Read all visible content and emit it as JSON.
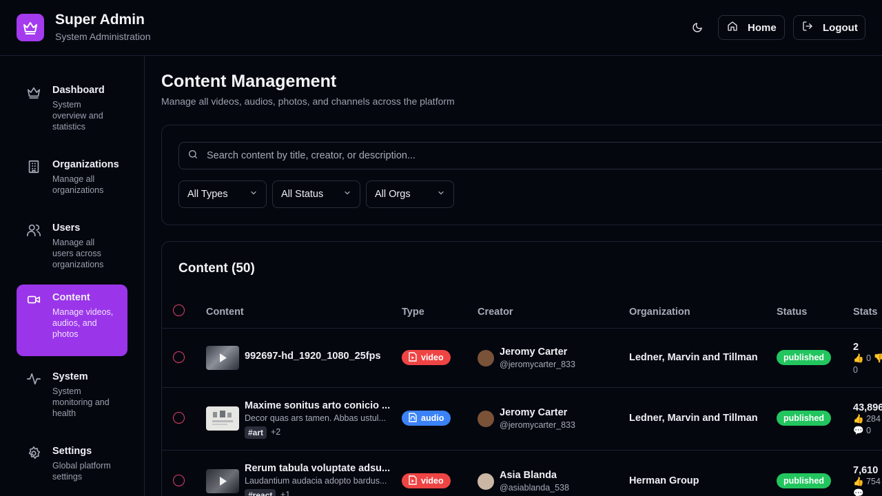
{
  "header": {
    "title": "Super Admin",
    "subtitle": "System Administration",
    "home_label": "Home",
    "logout_label": "Logout"
  },
  "sidebar": {
    "items": [
      {
        "label": "Dashboard",
        "desc": [
          "System",
          "overview and",
          "statistics"
        ],
        "icon": "crown-icon"
      },
      {
        "label": "Organizations",
        "desc": [
          "Manage all",
          "organizations"
        ],
        "icon": "building-icon"
      },
      {
        "label": "Users",
        "desc": [
          "Manage all",
          "users across",
          "organizations"
        ],
        "icon": "users-icon"
      },
      {
        "label": "Content",
        "desc": [
          "Manage videos,",
          "audios, and",
          "photos"
        ],
        "icon": "video-icon",
        "active": true
      },
      {
        "label": "System",
        "desc": [
          "System",
          "monitoring and",
          "health"
        ],
        "icon": "activity-icon"
      },
      {
        "label": "Settings",
        "desc": [
          "Global platform",
          "settings"
        ],
        "icon": "gear-icon"
      }
    ]
  },
  "main": {
    "title": "Content Management",
    "subtitle": "Manage all videos, audios, photos, and channels across the platform",
    "search_placeholder": "Search content by title, creator, or description...",
    "filters": [
      "All Types",
      "All Status",
      "All Orgs"
    ],
    "content_title": "Content (50)",
    "columns": [
      "Content",
      "Type",
      "Creator",
      "Organization",
      "Status",
      "Stats"
    ],
    "rows": [
      {
        "title": "992697-hd_1920_1080_25fps",
        "type": "video",
        "creator": "Jeromy Carter",
        "handle": "@jeromycarter_833",
        "organization": "Ledner, Marvin and Tillman",
        "status": "published",
        "views": "2",
        "likes": "0",
        "comments": "0"
      },
      {
        "title": "Maxime sonitus arto conicio ...",
        "description": "Decor quas ars tamen. Abbas ustul...",
        "tag": "#art",
        "more_tags": "+2",
        "type": "audio",
        "creator": "Jeromy Carter",
        "handle": "@jeromycarter_833",
        "organization": "Ledner, Marvin and Tillman",
        "status": "published",
        "views": "43,896",
        "likes": "284",
        "comments": "0"
      },
      {
        "title": "Rerum tabula voluptate adsu...",
        "description": "Laudantium audacia adopto bardus...",
        "tag": "#react",
        "more_tags": "+1",
        "type": "video",
        "creator": "Asia Blanda",
        "handle": "@asiablanda_538",
        "organization": "Herman Group",
        "status": "published",
        "views": "7,610",
        "likes": "754",
        "comments": ""
      }
    ]
  },
  "colors": {
    "accent": "#9b35ea",
    "video_badge": "#ef4444",
    "audio_badge": "#3b82f6",
    "published": "#22c55e",
    "background": "#05070f"
  }
}
